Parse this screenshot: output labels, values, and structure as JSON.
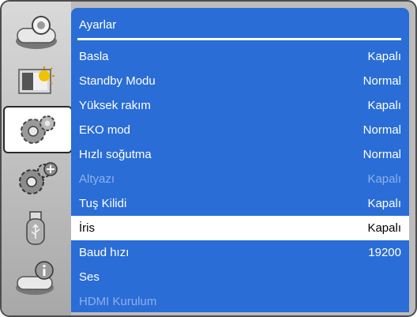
{
  "panel": {
    "title": "Ayarlar"
  },
  "sidebar": {
    "items": [
      {
        "icon": "projector-icon"
      },
      {
        "icon": "image-adjust-icon"
      },
      {
        "icon": "settings-gears-icon",
        "active": true
      },
      {
        "icon": "advanced-settings-icon"
      },
      {
        "icon": "usb-icon"
      },
      {
        "icon": "info-icon"
      }
    ]
  },
  "menu": {
    "items": [
      {
        "label": "Basla",
        "value": "Kapalı"
      },
      {
        "label": "Standby Modu",
        "value": "Normal"
      },
      {
        "label": "Yüksek rakım",
        "value": "Kapalı"
      },
      {
        "label": "EKO mod",
        "value": "Normal"
      },
      {
        "label": "Hızlı soğutma",
        "value": "Normal"
      },
      {
        "label": "Altyazı",
        "value": "Kapalı",
        "disabled": true
      },
      {
        "label": "Tuş Kilidi",
        "value": "Kapalı"
      },
      {
        "label": "İris",
        "value": "Kapalı",
        "selected": true
      },
      {
        "label": "Baud hızı",
        "value": "19200"
      },
      {
        "label": "Ses",
        "value": ""
      },
      {
        "label": "HDMI Kurulum",
        "value": "",
        "disabled": true
      }
    ]
  },
  "colors": {
    "panel_bg": "#2a6dd6",
    "highlight_bg": "#ffffff",
    "disabled_text": "#8fb0e8",
    "sidebar_bg": "#bcbcbc"
  }
}
